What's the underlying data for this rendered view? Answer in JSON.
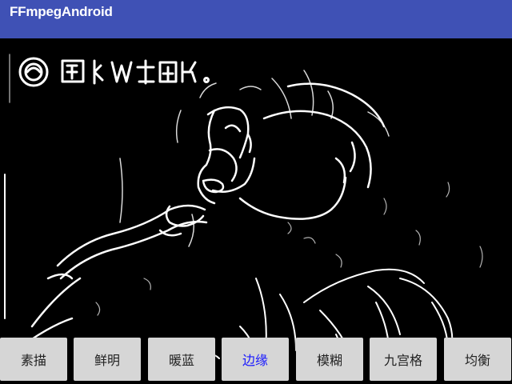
{
  "app_bar": {
    "title": "FFmpegAndroid",
    "color": "#3f51b5"
  },
  "video": {
    "description_icon": "edge-detected-video-frame",
    "watermark_icon": "channel-logo-watermark"
  },
  "filters": {
    "active_color": "#1a1aff",
    "items": [
      {
        "label": "素描",
        "active": false
      },
      {
        "label": "鲜明",
        "active": false
      },
      {
        "label": "暖蓝",
        "active": false
      },
      {
        "label": "边缘",
        "active": true
      },
      {
        "label": "模糊",
        "active": false
      },
      {
        "label": "九宫格",
        "active": false
      },
      {
        "label": "均衡",
        "active": false
      }
    ]
  }
}
